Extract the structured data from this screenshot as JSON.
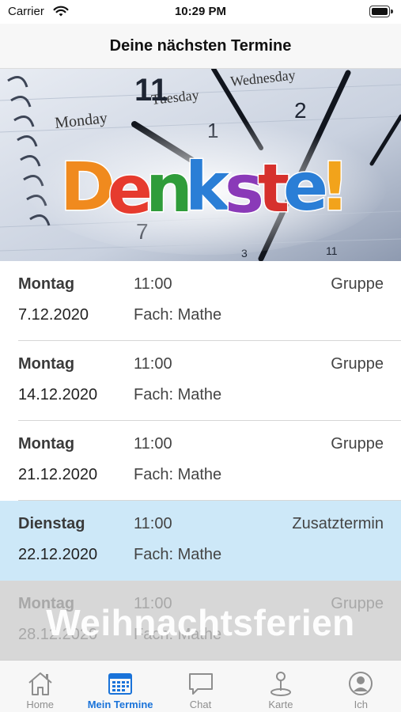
{
  "status_bar": {
    "carrier": "Carrier",
    "time": "10:29 PM",
    "wifi_icon": "wifi-icon",
    "battery_icon": "battery-icon"
  },
  "nav": {
    "title": "Deine nächsten Termine"
  },
  "banner": {
    "logo_text": "Denkste!",
    "calendar_words": [
      "Monday",
      "Tuesday",
      "Wednesday"
    ],
    "clock_numbers": [
      "11",
      "1",
      "2",
      "7",
      "3",
      "11"
    ]
  },
  "appointments": [
    {
      "day": "Montag",
      "date": "7.12.2020",
      "time": "11:00",
      "subject": "Fach: Mathe",
      "type": "Gruppe",
      "highlight": false
    },
    {
      "day": "Montag",
      "date": "14.12.2020",
      "time": "11:00",
      "subject": "Fach: Mathe",
      "type": "Gruppe",
      "highlight": false
    },
    {
      "day": "Montag",
      "date": "21.12.2020",
      "time": "11:00",
      "subject": "Fach: Mathe",
      "type": "Gruppe",
      "highlight": false
    },
    {
      "day": "Dienstag",
      "date": "22.12.2020",
      "time": "11:00",
      "subject": "Fach: Mathe",
      "type": "Zusatztermin",
      "highlight": true
    },
    {
      "day": "Montag",
      "date": "28.12.2020",
      "time": "11:00",
      "subject": "Fach: Mathe",
      "type": "Gruppe",
      "highlight": false,
      "overlay_label": "Weihnachtsferien"
    }
  ],
  "tabs": [
    {
      "label": "Home",
      "icon": "home-icon",
      "active": false
    },
    {
      "label": "Mein Termine",
      "icon": "calendar-icon",
      "active": true
    },
    {
      "label": "Chat",
      "icon": "chat-icon",
      "active": false
    },
    {
      "label": "Karte",
      "icon": "map-pin-icon",
      "active": false
    },
    {
      "label": "Ich",
      "icon": "profile-icon",
      "active": false
    }
  ],
  "colors": {
    "accent": "#1a73d9",
    "highlight_row": "#cde8f8",
    "tab_inactive": "#8e8e8e"
  }
}
